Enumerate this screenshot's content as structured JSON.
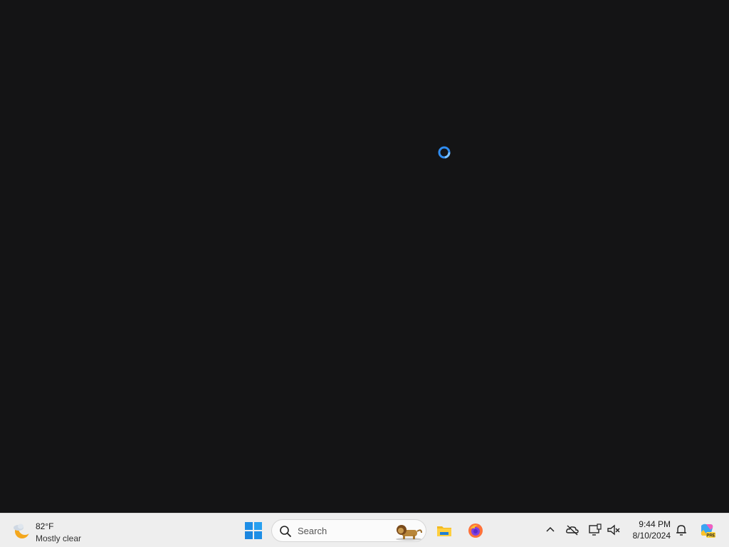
{
  "desktop": {
    "background": "#141415",
    "loading_indicator": {
      "icon": "loading-spinner-icon",
      "color": "#2f8cf0"
    }
  },
  "taskbar": {
    "weather": {
      "temperature": "82°F",
      "condition": "Mostly clear",
      "icon": "moon-cloud-icon"
    },
    "start": {
      "icon": "windows-start-icon",
      "accent": "#1e8ee6"
    },
    "search": {
      "placeholder": "Search",
      "icon": "search-icon",
      "highlight_icon": "lion-search-highlight-icon"
    },
    "pinned_apps": [
      {
        "name": "file-explorer",
        "icon": "folder-icon"
      },
      {
        "name": "firefox",
        "icon": "firefox-icon"
      }
    ],
    "tray": {
      "icons": [
        "chevron-up-icon",
        "onedrive-offline-icon",
        "display-icon",
        "speaker-muted-icon"
      ],
      "time": "9:44 PM",
      "date": "8/10/2024",
      "notification_icon": "notification-bell-icon",
      "copilot_icon": "copilot-pre-icon"
    }
  }
}
